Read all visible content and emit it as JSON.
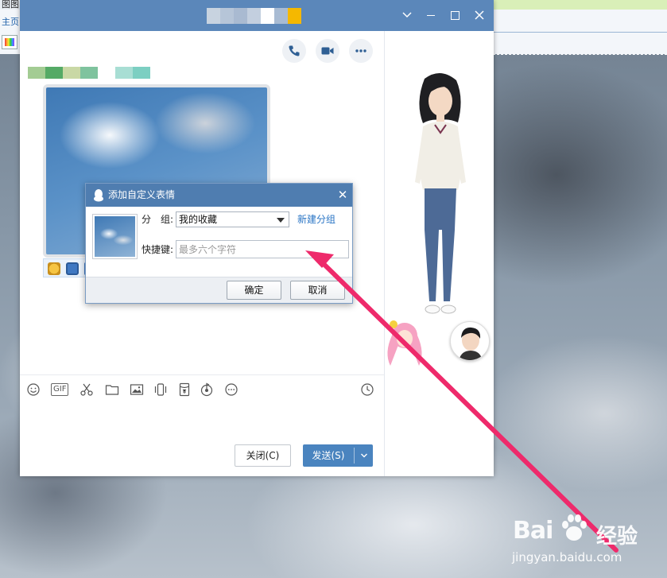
{
  "background_window": {
    "menu_text": "图图",
    "nav_text": "主页"
  },
  "chat": {
    "header_color": "#5b87ba",
    "title_blocks": [
      "#c8d3e0",
      "#b6c5d8",
      "#a9bad1",
      "#c3cfdf",
      "#ffffff",
      "#a8bbd3",
      "#f5b800"
    ],
    "sender_blocks": [
      "#a3cc93",
      "#55aa66",
      "#c9d8a5",
      "#7fc39e",
      "#ffffff",
      "#a8ded4",
      "#7ccfc2"
    ],
    "actions": [
      "phone-icon",
      "video-icon",
      "more-icon"
    ],
    "toolbar_icons": [
      "emoji-icon",
      "gif-icon",
      "scissors-icon",
      "folder-icon",
      "image-icon",
      "shake-icon",
      "red-packet-icon",
      "music-icon",
      "more-circle-icon",
      "history-clock-icon"
    ],
    "gif_label": "GIF",
    "close_label": "关闭(C)",
    "send_label": "发送(S)",
    "send_dropdown_icon": "chevron-down-icon"
  },
  "dialog": {
    "title": "添加自定义表情",
    "group_label": "分　组:",
    "group_value": "我的收藏",
    "new_group_link": "新建分组",
    "shortcut_label": "快捷键:",
    "shortcut_placeholder": "最多六个字符",
    "shortcut_value": "",
    "ok_label": "确定",
    "cancel_label": "取消"
  },
  "annotation": {
    "color": "#ee2a6b"
  },
  "watermark": {
    "brand": "Bai",
    "brand_suffix": "经验",
    "url": "jingyan.baidu.com"
  }
}
